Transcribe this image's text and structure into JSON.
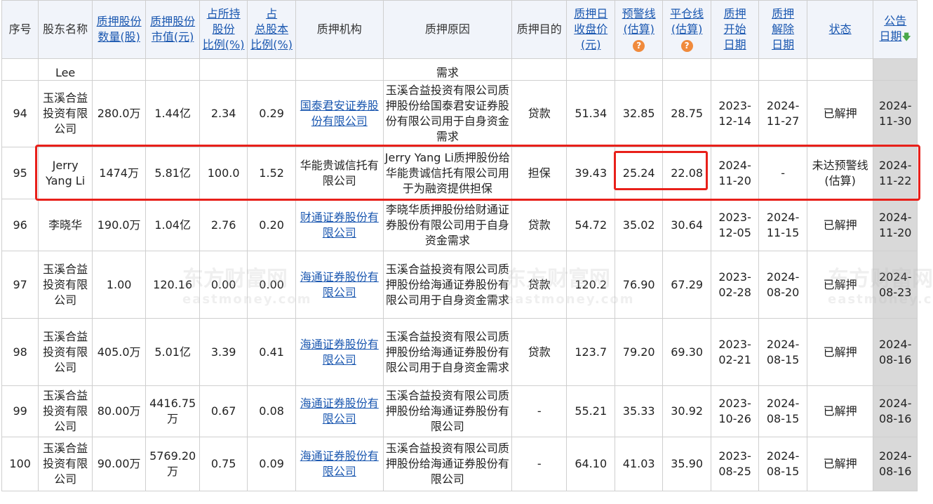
{
  "headers": {
    "seq": "序号",
    "holder": "股东名称",
    "shares": [
      "质押股份",
      "数量(股)"
    ],
    "mktval": [
      "质押股份",
      "市值(元)"
    ],
    "pct_held": [
      "占所持",
      "股份",
      "比例(%)"
    ],
    "pct_total": [
      "占",
      "总股本",
      "比例(%)"
    ],
    "org": "质押机构",
    "reason": "质押原因",
    "purpose": "质押目的",
    "close": [
      "质押日",
      "收盘价",
      "(元)"
    ],
    "warn": [
      "预警线",
      "(估算)"
    ],
    "liq": [
      "平仓线",
      "(估算)"
    ],
    "start": [
      "质押",
      "开始",
      "日期"
    ],
    "release": [
      "质押",
      "解除",
      "日期"
    ],
    "status": "状态",
    "announce": [
      "公告",
      "日期"
    ],
    "warn_icon": "?",
    "sort_icon": "🡇"
  },
  "partial_row": {
    "holder": "Lee",
    "reason": "需求"
  },
  "rows": [
    {
      "seq": "94",
      "holder": "玉溪合益投资有限公司",
      "shares": "280.0万",
      "mktval": "1.44亿",
      "pct_held": "2.34",
      "pct_total": "0.29",
      "org": "国泰君安证券股份有限公司",
      "org_link": true,
      "reason": "玉溪合益投资有限公司质押股份给国泰君安证券股份有限公司用于自身资金需求",
      "purpose": "贷款",
      "close": "51.34",
      "warn": "32.85",
      "liq": "28.75",
      "start": "2023-12-14",
      "release": "2024-11-27",
      "status": "已解押",
      "announce": "2024-11-30"
    },
    {
      "seq": "95",
      "holder": "Jerry Yang Li",
      "shares": "1474万",
      "mktval": "5.81亿",
      "pct_held": "100.0",
      "pct_total": "1.52",
      "org": "华能贵诚信托有限公司",
      "org_link": false,
      "reason": "Jerry Yang Li质押股份给华能贵诚信托有限公司用于为融资提供担保",
      "purpose": "担保",
      "close": "39.43",
      "warn": "25.24",
      "liq": "22.08",
      "start": "2024-11-20",
      "release": "-",
      "status": "未达预警线(估算)",
      "announce": "2024-11-22"
    },
    {
      "seq": "96",
      "holder": "李晓华",
      "shares": "190.0万",
      "mktval": "1.04亿",
      "pct_held": "2.76",
      "pct_total": "0.20",
      "org": "财通证券股份有限公司",
      "org_link": true,
      "reason": "李晓华质押股份给财通证券股份有限公司用于自身资金需求",
      "purpose": "贷款",
      "close": "54.72",
      "warn": "35.02",
      "liq": "30.64",
      "start": "2023-12-05",
      "release": "2024-11-15",
      "status": "已解押",
      "announce": "2024-11-20"
    },
    {
      "seq": "97",
      "holder": "玉溪合益投资有限公司",
      "shares": "1.00",
      "mktval": "120.16",
      "pct_held": "0.00",
      "pct_total": "0.00",
      "org": "海通证券股份有限公司",
      "org_link": true,
      "reason": "玉溪合益投资有限公司质押股份给海通证券股份有限公司用于自身资金需求",
      "purpose": "贷款",
      "close": "120.2",
      "warn": "76.90",
      "liq": "67.29",
      "start": "2023-02-28",
      "release": "2024-08-20",
      "status": "已解押",
      "announce": "2024-08-23"
    },
    {
      "seq": "98",
      "holder": "玉溪合益投资有限公司",
      "shares": "405.0万",
      "mktval": "5.01亿",
      "pct_held": "3.39",
      "pct_total": "0.41",
      "org": "海通证券股份有限公司",
      "org_link": true,
      "reason": "玉溪合益投资有限公司质押股份给海通证券股份有限公司用于自身资金需求",
      "purpose": "贷款",
      "close": "123.7",
      "warn": "79.20",
      "liq": "69.30",
      "start": "2023-02-21",
      "release": "2024-08-15",
      "status": "已解押",
      "announce": "2024-08-16"
    },
    {
      "seq": "99",
      "holder": "玉溪合益投资有限公司",
      "shares": "80.00万",
      "mktval": "4416.75万",
      "pct_held": "0.67",
      "pct_total": "0.08",
      "org": "海通证券股份有限公司",
      "org_link": true,
      "reason": "玉溪合益投资有限公司质押股份给海通证券股份有限公司",
      "purpose": "-",
      "close": "55.21",
      "warn": "35.33",
      "liq": "30.92",
      "start": "2023-10-26",
      "release": "2024-08-15",
      "status": "已解押",
      "announce": "2024-08-16"
    },
    {
      "seq": "100",
      "holder": "玉溪合益投资有限公司",
      "shares": "90.00万",
      "mktval": "5769.20万",
      "pct_held": "0.75",
      "pct_total": "0.09",
      "org": "海通证券股份有限公司",
      "org_link": true,
      "reason": "玉溪合益投资有限公司质押股份给海通证券股份有限公司",
      "purpose": "-",
      "close": "64.10",
      "warn": "41.03",
      "liq": "35.90",
      "start": "2023-08-25",
      "release": "2024-08-15",
      "status": "已解押",
      "announce": "2024-08-16"
    }
  ],
  "watermark": {
    "cn": "东方财富网",
    "en": "eastmoney.com"
  },
  "colors": {
    "highlight": "#e8201a",
    "link": "#1a57b0",
    "header_bg": "#f1f4fa",
    "date_col_bg": "#d9d9d9",
    "warn_icon": "#f08a3c"
  }
}
